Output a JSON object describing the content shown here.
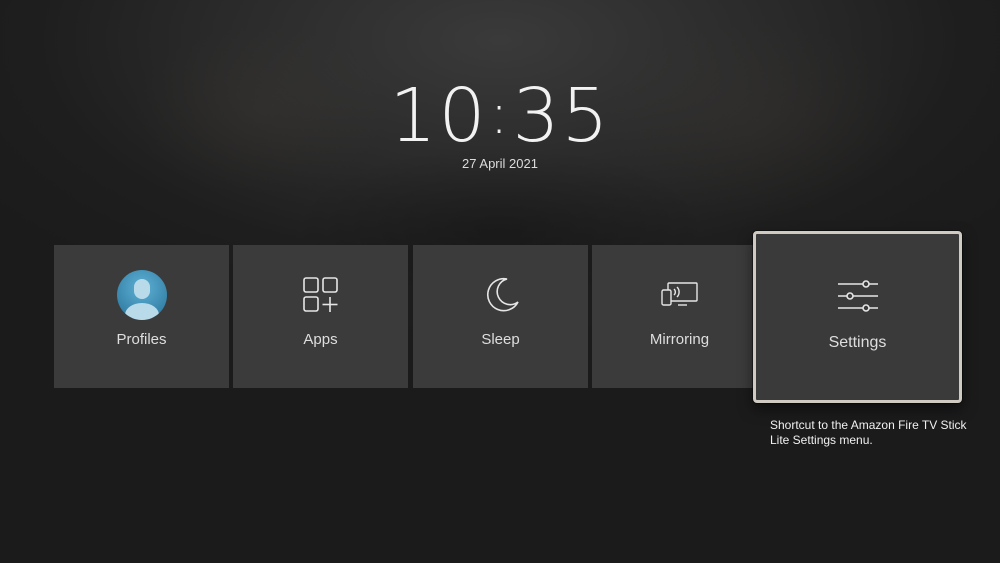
{
  "clock": {
    "hours": "10",
    "minutes": "35",
    "date": "27 April 2021"
  },
  "tiles": [
    {
      "label": "Profiles",
      "icon": "profile-avatar-icon"
    },
    {
      "label": "Apps",
      "icon": "apps-grid-icon"
    },
    {
      "label": "Sleep",
      "icon": "moon-icon"
    },
    {
      "label": "Mirroring",
      "icon": "screen-mirroring-icon"
    },
    {
      "label": "Settings",
      "icon": "sliders-icon",
      "focused": true
    }
  ],
  "tooltip": {
    "text": "Shortcut to the Amazon Fire TV Stick Lite Settings menu."
  },
  "colors": {
    "tile_bg": "#3b3b3b",
    "focus_border": "#cfcac2",
    "avatar_blue": "#3a8bb0"
  }
}
